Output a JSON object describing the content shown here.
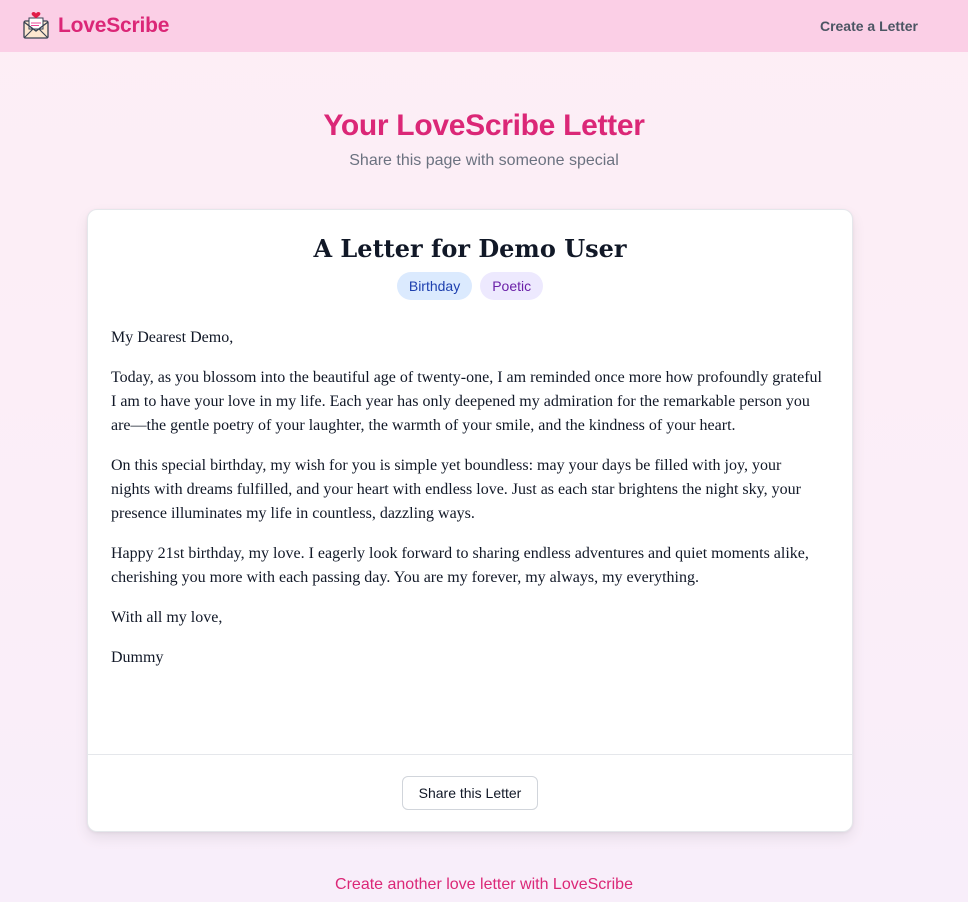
{
  "nav": {
    "brand": "LoveScribe",
    "logo_icon": "love-letter-envelope-icon",
    "create_link": "Create a Letter"
  },
  "hero": {
    "title": "Your LoveScribe Letter",
    "subtitle": "Share this page with someone special"
  },
  "letter": {
    "title": "A Letter for Demo User",
    "tags": [
      "Birthday",
      "Poetic"
    ],
    "paragraphs": [
      "My Dearest Demo,",
      "Today, as you blossom into the beautiful age of twenty-one, I am reminded once more how profoundly grateful I am to have your love in my life. Each year has only deepened my admiration for the remarkable person you are—the gentle poetry of your laughter, the warmth of your smile, and the kindness of your heart.",
      "On this special birthday, my wish for you is simple yet boundless: may your days be filled with joy, your nights with dreams fulfilled, and your heart with endless love. Just as each star brightens the night sky, your presence illuminates my life in countless, dazzling ways.",
      "Happy 21st birthday, my love. I eagerly look forward to sharing endless adventures and quiet moments alike, cherishing you more with each passing day. You are my forever, my always, my everything.",
      "With all my love,",
      "Dummy"
    ],
    "share_button": "Share this Letter"
  },
  "footer": {
    "link": "Create another love letter with LoveScribe"
  },
  "colors": {
    "brand_pink": "#db2777",
    "navbar_bg": "#fbcfe6",
    "badge_birthday_bg": "#dbeafe",
    "badge_poetic_bg": "#ede9fe"
  }
}
